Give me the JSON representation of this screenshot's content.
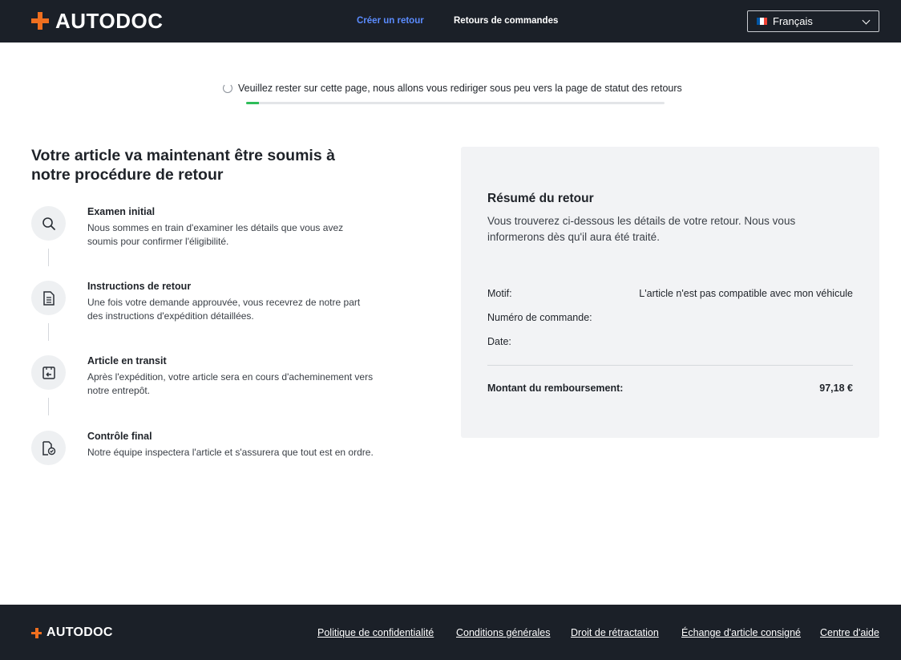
{
  "header": {
    "logo_text": "AUTODOC",
    "nav": {
      "create_return": "Créer un retour",
      "order_returns": "Retours de commandes"
    },
    "language": {
      "selected": "Français",
      "flag_colors": [
        "#0055a4",
        "#ffffff",
        "#ef4135"
      ]
    }
  },
  "redirect": {
    "message": "Veuillez rester sur cette page, nous allons vous rediriger sous peu vers la page de statut des retours",
    "progress_percent": 3
  },
  "procedure": {
    "title": "Votre article va maintenant être soumis à notre procédure de retour",
    "steps": [
      {
        "icon": "search-icon",
        "title": "Examen initial",
        "description": "Nous sommes en train d'examiner les détails que vous avez soumis pour confirmer l'éligibilité."
      },
      {
        "icon": "document-icon",
        "title": "Instructions de retour",
        "description": "Une fois votre demande approuvée, vous recevrez de notre part des instructions d'expédition détaillées."
      },
      {
        "icon": "package-return-icon",
        "title": "Article en transit",
        "description": "Après l'expédition, votre article sera en cours d'acheminement vers notre entrepôt."
      },
      {
        "icon": "document-check-icon",
        "title": "Contrôle final",
        "description": "Notre équipe inspectera l'article et s'assurera que tout est en ordre."
      }
    ]
  },
  "summary": {
    "title": "Résumé du retour",
    "description": "Vous trouverez ci-dessous les détails de votre retour. Nous vous informerons dès qu'il aura été traité.",
    "reason_label": "Motif:",
    "reason_value": "L'article n'est pas compatible avec mon véhicule",
    "order_number_label": "Numéro de commande:",
    "order_number_value": "",
    "date_label": "Date:",
    "date_value": "",
    "refund_label": "Montant du remboursement:",
    "refund_value": "97,18 €"
  },
  "footer": {
    "logo_text": "AUTODOC",
    "links": {
      "privacy": "Politique de confidentialité",
      "terms": "Conditions générales",
      "withdrawal": "Droit de rétractation",
      "deposit_exchange": "Échange d'article consigné",
      "help_center": "Centre d'aide"
    }
  },
  "colors": {
    "header_bg": "#1b2028",
    "brand_orange": "#ef6f1f",
    "active_nav": "#5b8cff",
    "progress_green": "#2ebd59",
    "card_bg": "#f2f3f5"
  }
}
